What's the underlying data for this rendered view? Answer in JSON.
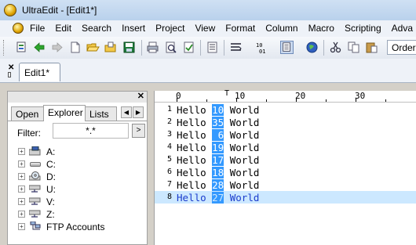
{
  "window": {
    "title": "UltraEdit - [Edit1*]"
  },
  "menu": [
    "File",
    "Edit",
    "Search",
    "Insert",
    "Project",
    "View",
    "Format",
    "Column",
    "Macro",
    "Scripting",
    "Adva"
  ],
  "toolbar": {
    "order_label": "Order",
    "icons": [
      "new-project-icon",
      "back-arrow-icon",
      "forward-arrow-icon",
      "new-file-icon",
      "open-folder-icon",
      "open-file-icon",
      "save-icon",
      "print-icon",
      "print-preview-icon",
      "spell-check-icon",
      "document-icon",
      "word-wrap-icon",
      "hex-mode-icon",
      "column-mode-icon",
      "globe-icon",
      "cut-icon",
      "copy-icon",
      "paste-icon"
    ]
  },
  "tabs": {
    "document": "Edit1*"
  },
  "left_pane": {
    "tabs": [
      "Open",
      "Explorer",
      "Lists"
    ],
    "active_tab": "Explorer",
    "filter_label": "Filter:",
    "filter_value": "*.*",
    "filter_button": ">",
    "tree": [
      {
        "label": "A:",
        "icon": "floppy-drive-icon"
      },
      {
        "label": "C:",
        "icon": "hard-drive-icon"
      },
      {
        "label": "D:",
        "icon": "cd-drive-icon"
      },
      {
        "label": "U:",
        "icon": "network-drive-icon"
      },
      {
        "label": "V:",
        "icon": "network-drive-icon"
      },
      {
        "label": "Z:",
        "icon": "network-drive-icon"
      },
      {
        "label": "FTP Accounts",
        "icon": "ftp-accounts-icon"
      }
    ]
  },
  "ruler": {
    "labels": [
      "0",
      "10",
      "20",
      "30"
    ]
  },
  "editor": {
    "lines": [
      {
        "num": "1",
        "pre": "Hello ",
        "sel": "10",
        "post": " World"
      },
      {
        "num": "2",
        "pre": "Hello ",
        "sel": "35",
        "post": " World"
      },
      {
        "num": "3",
        "pre": "Hello ",
        "sel": " 6",
        "post": " World"
      },
      {
        "num": "4",
        "pre": "Hello ",
        "sel": "19",
        "post": " World"
      },
      {
        "num": "5",
        "pre": "Hello ",
        "sel": "17",
        "post": " World"
      },
      {
        "num": "6",
        "pre": "Hello ",
        "sel": "18",
        "post": " World"
      },
      {
        "num": "7",
        "pre": "Hello ",
        "sel": "28",
        "post": " World"
      },
      {
        "num": "8",
        "pre": "Hello ",
        "sel": "27",
        "post": " World"
      }
    ],
    "current_line": 8
  },
  "colors": {
    "selection": "#3399ff",
    "current_line": "#cce8ff"
  }
}
